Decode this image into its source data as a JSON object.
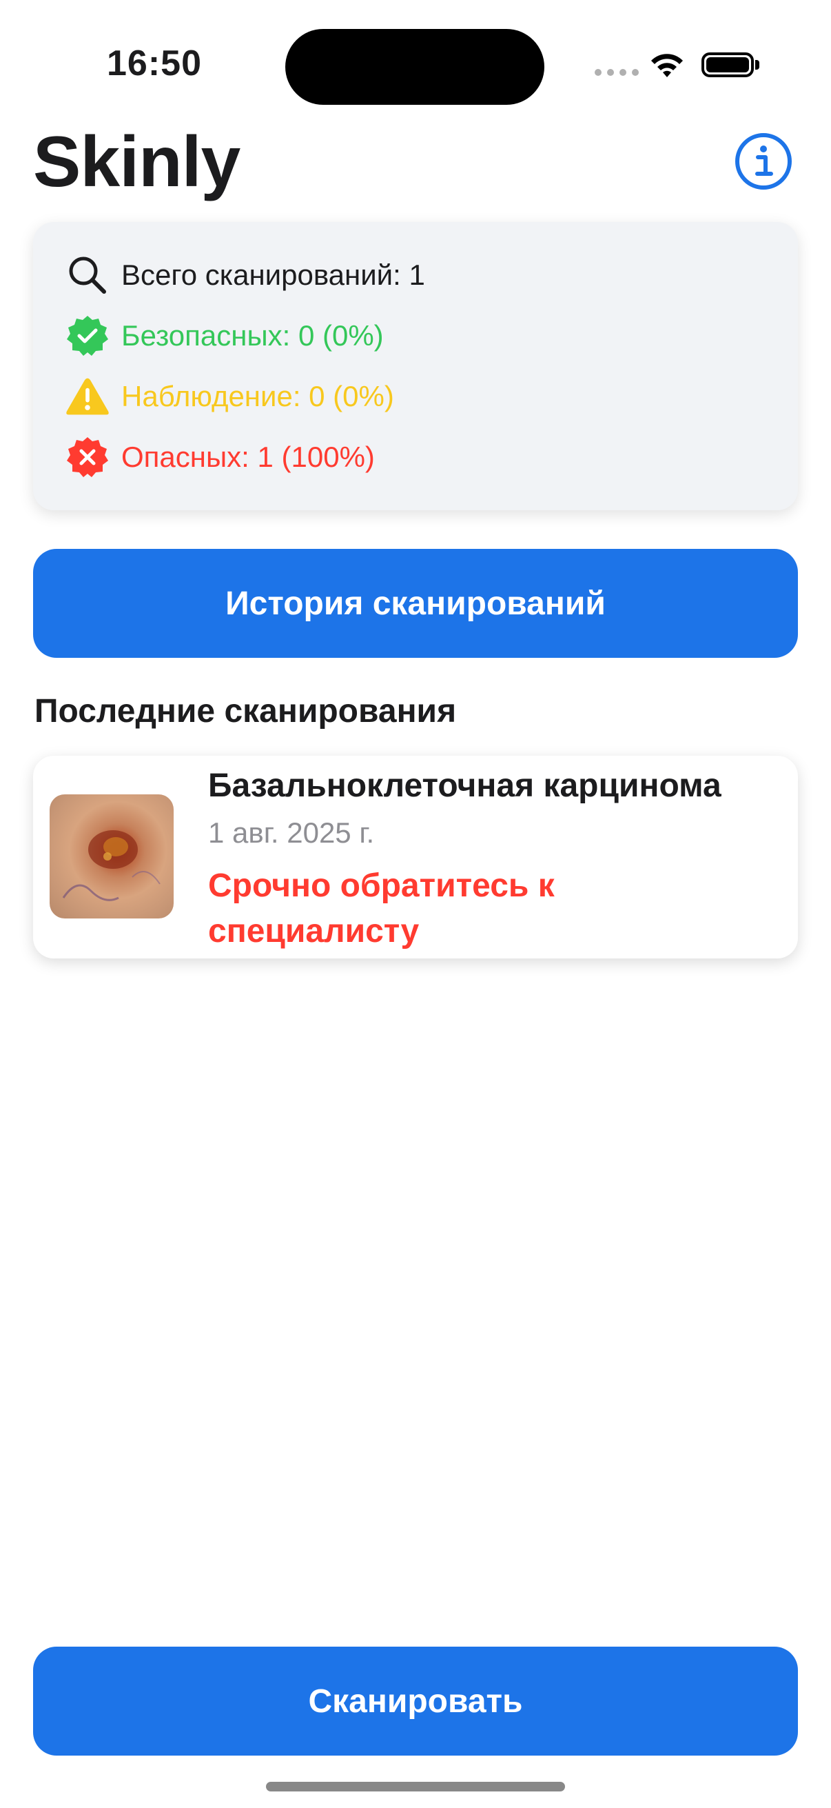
{
  "status_bar": {
    "time": "16:50"
  },
  "header": {
    "title": "Skinly",
    "info_icon": "info-circle-icon"
  },
  "stats": {
    "total": "Всего сканирований: 1",
    "safe": "Безопасных: 0 (0%)",
    "watch": "Наблюдение: 0 (0%)",
    "dangerous": "Опасных: 1 (100%)",
    "colors": {
      "safe": "#34c759",
      "watch": "#f8c81e",
      "dangerous": "#ff3b30"
    }
  },
  "history_button": {
    "label": "История сканирований"
  },
  "recent": {
    "title": "Последние сканирования",
    "items": [
      {
        "diagnosis": "Базальноклеточная карцинома",
        "date": "1 авг. 2025 г.",
        "status": "Срочно обратитесь к специалисту"
      }
    ]
  },
  "scan_button": {
    "label": "Сканировать"
  },
  "colors": {
    "accent": "#1d74e8"
  }
}
